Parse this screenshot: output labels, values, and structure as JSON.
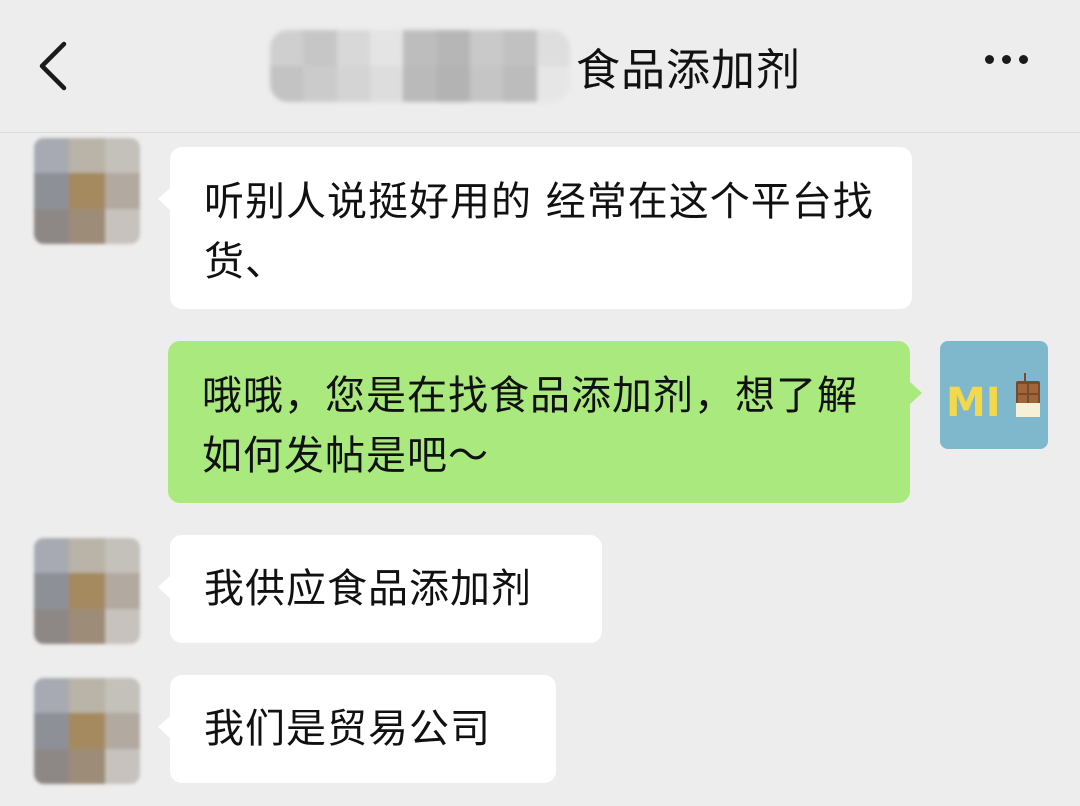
{
  "header": {
    "title": "食品添加剂",
    "back_icon": "chevron-left-icon",
    "more_icon": "more-horizontal-icon"
  },
  "messages": [
    {
      "side": "in",
      "text": "听别人说挺好用的 经常在这个平台找货、"
    },
    {
      "side": "out",
      "text": "哦哦，您是在找食品添加剂，想了解如何发帖是吧～"
    },
    {
      "side": "in",
      "text": "我供应食品添加剂"
    },
    {
      "side": "in",
      "text": "我们是贸易公司"
    }
  ],
  "my_avatar": {
    "text": "MI",
    "background": "#7fb8cc",
    "text_color": "#f2d84a"
  },
  "colors": {
    "page_bg": "#ededed",
    "incoming_bubble": "#ffffff",
    "outgoing_bubble": "#a9e97d"
  }
}
